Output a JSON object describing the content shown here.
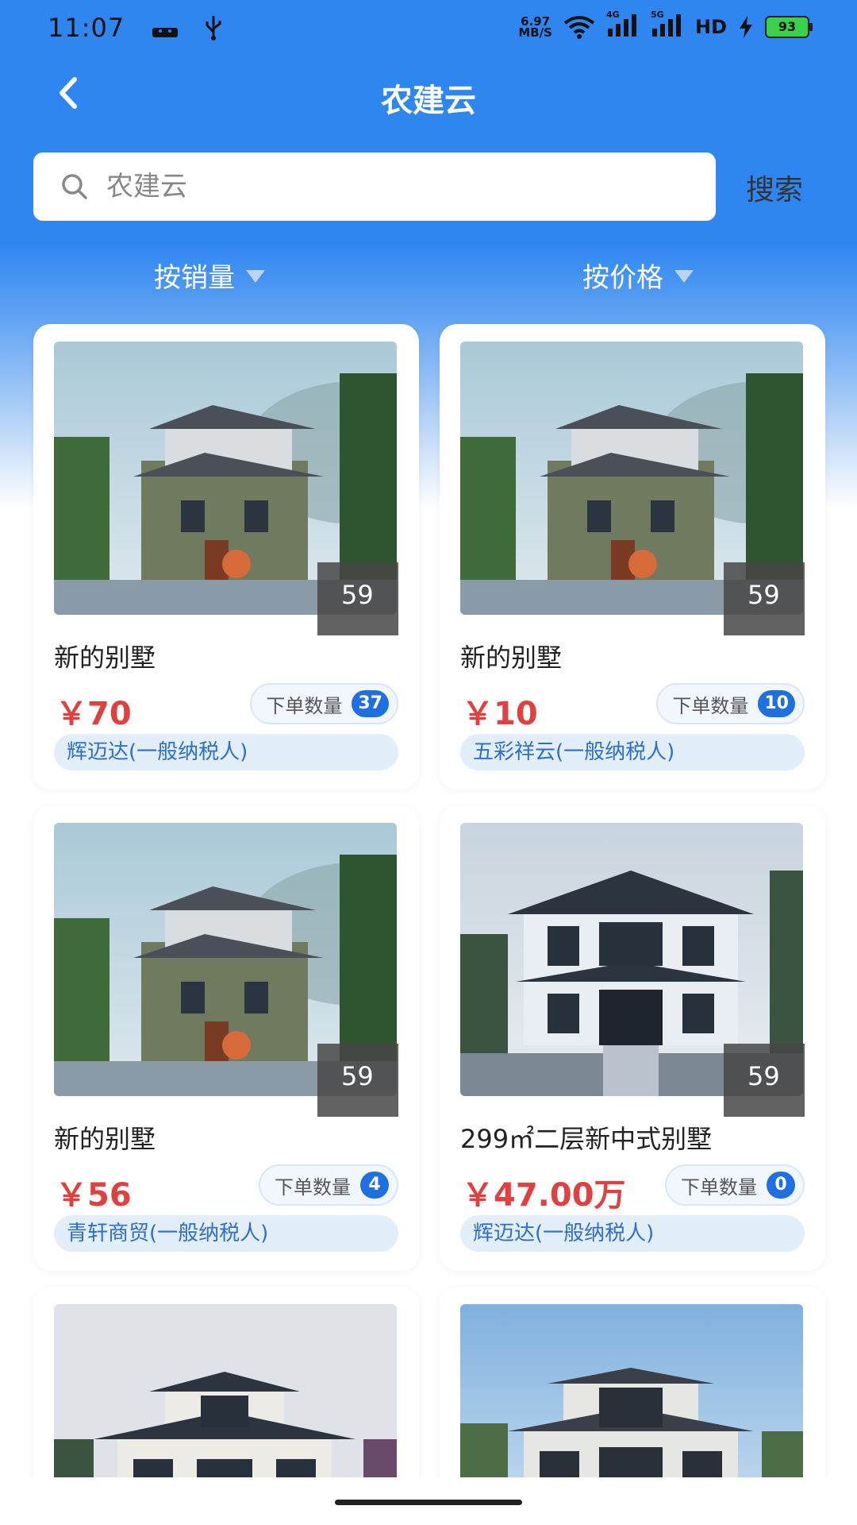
{
  "status_bar": {
    "time": "11:07",
    "net_speed_value": "6.97",
    "net_speed_unit": "MB/S",
    "signal_1": "4G",
    "signal_2": "5G",
    "hd": "HD",
    "battery": "93"
  },
  "nav": {
    "title": "农建云",
    "back_icon": "chevron-left-icon"
  },
  "search": {
    "placeholder": "农建云",
    "button_label": "搜索",
    "icon": "search-icon"
  },
  "sort": [
    {
      "label": "按销量",
      "icon": "triangle-down-icon"
    },
    {
      "label": "按价格",
      "icon": "triangle-down-icon"
    }
  ],
  "colors": {
    "header_blue": "#2f86f1",
    "price_red": "#e04040",
    "badge_blue": "#1e6fe0",
    "seller_tag_bg": "#e3eefb",
    "seller_tag_text": "#2f6fc8"
  },
  "products": [
    {
      "image_count": "59",
      "title": "新的别墅",
      "price": "￥70",
      "order_label": "下单数量",
      "order_count": "37",
      "seller": "辉迈达(一般纳税人)",
      "image": "villa-green-photo"
    },
    {
      "image_count": "59",
      "title": "新的别墅",
      "price": "￥10",
      "order_label": "下单数量",
      "order_count": "10",
      "seller": "五彩祥云(一般纳税人)",
      "image": "villa-green-photo"
    },
    {
      "image_count": "59",
      "title": "新的别墅",
      "price": "￥56",
      "order_label": "下单数量",
      "order_count": "4",
      "seller": "青轩商贸(一般纳税人)",
      "image": "villa-green-photo"
    },
    {
      "image_count": "59",
      "title": "299㎡二层新中式别墅",
      "price": "￥47.00万",
      "order_label": "下单数量",
      "order_count": "0",
      "seller": "辉迈达(一般纳税人)",
      "image": "villa-white-night-photo"
    },
    {
      "image": "villa-white-photo"
    },
    {
      "image": "villa-dark-photo"
    }
  ]
}
